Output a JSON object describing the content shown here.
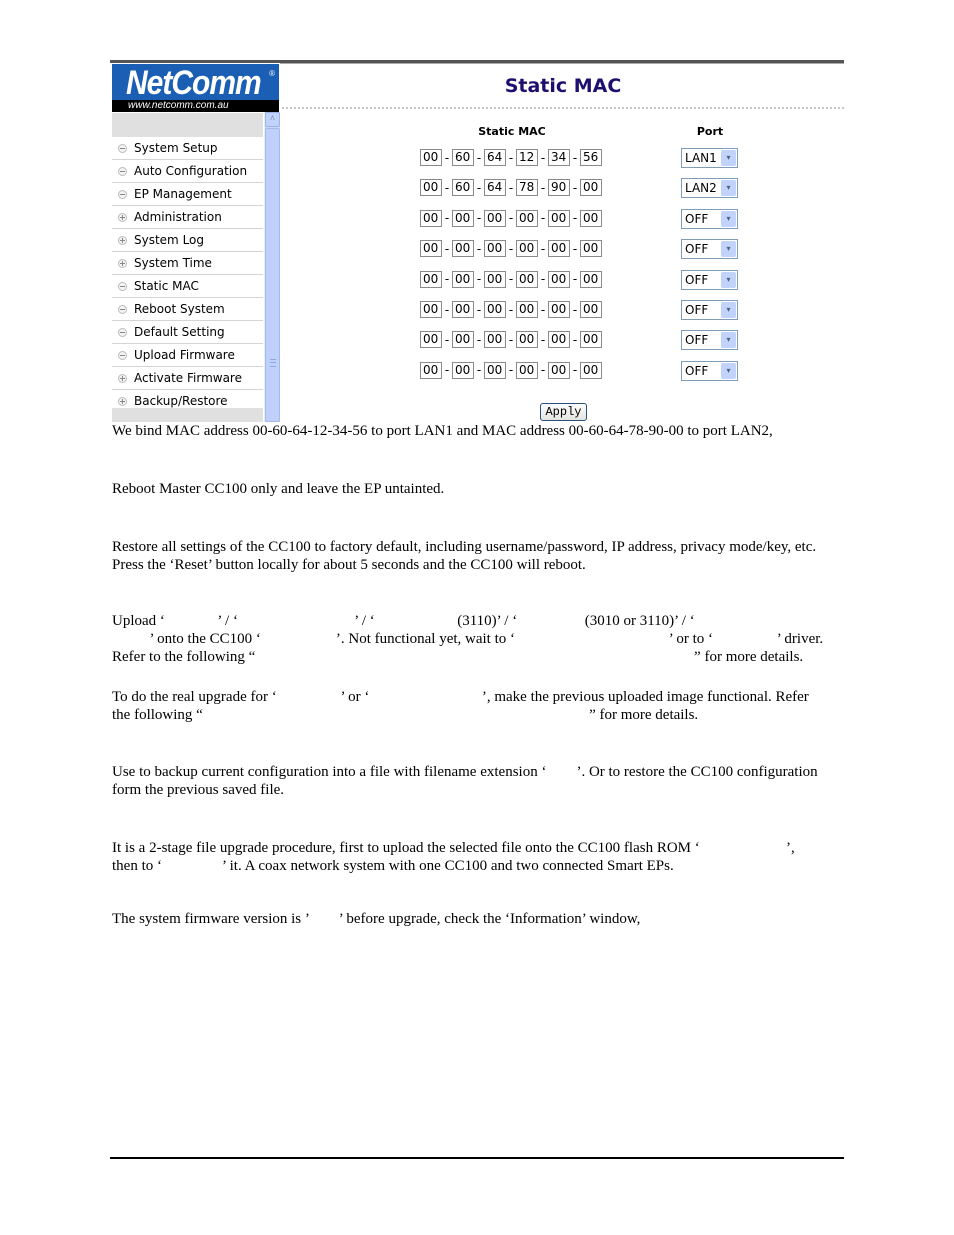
{
  "app": {
    "logo_brand": "NetComm",
    "logo_reg": "®",
    "logo_url": "www.netcomm.com.au",
    "page_title": "Static MAC"
  },
  "sidebar": {
    "items": [
      {
        "label": "System Setup",
        "icon": "minus-circle-icon"
      },
      {
        "label": "Auto Configuration",
        "icon": "minus-circle-icon"
      },
      {
        "label": "EP Management",
        "icon": "minus-circle-icon"
      },
      {
        "label": "Administration",
        "icon": "plus-circle-icon"
      },
      {
        "label": "System Log",
        "icon": "plus-circle-icon"
      },
      {
        "label": "System Time",
        "icon": "plus-circle-icon"
      },
      {
        "label": "Static MAC",
        "icon": "minus-circle-icon"
      },
      {
        "label": "Reboot System",
        "icon": "minus-circle-icon"
      },
      {
        "label": "Default Setting",
        "icon": "minus-circle-icon"
      },
      {
        "label": "Upload Firmware",
        "icon": "minus-circle-icon"
      },
      {
        "label": "Activate Firmware",
        "icon": "plus-circle-icon"
      },
      {
        "label": "Backup/Restore",
        "icon": "plus-circle-icon"
      }
    ],
    "scroll_up_glyph": "^"
  },
  "form": {
    "col_mac": "Static MAC",
    "col_port": "Port",
    "rows": [
      {
        "mac": [
          "00",
          "60",
          "64",
          "12",
          "34",
          "56"
        ],
        "port": "LAN1"
      },
      {
        "mac": [
          "00",
          "60",
          "64",
          "78",
          "90",
          "00"
        ],
        "port": "LAN2"
      },
      {
        "mac": [
          "00",
          "00",
          "00",
          "00",
          "00",
          "00"
        ],
        "port": "OFF"
      },
      {
        "mac": [
          "00",
          "00",
          "00",
          "00",
          "00",
          "00"
        ],
        "port": "OFF"
      },
      {
        "mac": [
          "00",
          "00",
          "00",
          "00",
          "00",
          "00"
        ],
        "port": "OFF"
      },
      {
        "mac": [
          "00",
          "00",
          "00",
          "00",
          "00",
          "00"
        ],
        "port": "OFF"
      },
      {
        "mac": [
          "00",
          "00",
          "00",
          "00",
          "00",
          "00"
        ],
        "port": "OFF"
      },
      {
        "mac": [
          "00",
          "00",
          "00",
          "00",
          "00",
          "00"
        ],
        "port": "OFF"
      }
    ],
    "separator": "-",
    "dropdown_glyph": "▾",
    "apply_label": "Apply"
  },
  "document": {
    "paragraphs": [
      {
        "lines": [
          "We bind MAC address 00-60-64-12-34-56 to port LAN1 and MAC address 00-60-64-78-90-00 to port LAN2,"
        ]
      },
      {
        "lines": [
          "Reboot Master CC100 only and leave the EP untainted."
        ]
      },
      {
        "lines": [
          "Restore all settings of the CC100 to factory default, including username/password, IP address, privacy mode/key, etc.",
          "Press the ‘Reset’ button locally for about 5 seconds and the CC100 will reboot."
        ]
      },
      {
        "lines": [
          "Upload ‘              ’ / ‘                               ’ / ‘                      (3110)’ / ‘                  (3010 or 3110)’ / ‘",
          "          ’ onto the CC100 ‘                    ’. Not functional yet, wait to ‘                                         ’ or to ‘                 ’ driver.",
          "Refer to the following “                                                                                                                     ” for more details."
        ]
      },
      {
        "lines": [
          "To do the real upgrade for ‘                 ’ or ‘                              ’, make the previous uploaded image functional. Refer",
          "the following “                                                                                                       ” for more details."
        ]
      },
      {
        "lines": [
          "Use to backup current configuration into a file with filename extension ‘        ’. Or to restore the CC100 configuration",
          "form the previous saved file."
        ]
      },
      {
        "lines": [
          "It is a 2-stage file upgrade procedure, first to upload the selected file onto the CC100 flash ROM ‘                       ’,",
          "then to ‘                ’ it. A coax network system with one CC100 and two connected Smart EPs."
        ]
      },
      {
        "lines": [
          "The system firmware version is ’        ’ before upgrade, check the ‘Information’ window,"
        ]
      }
    ]
  }
}
